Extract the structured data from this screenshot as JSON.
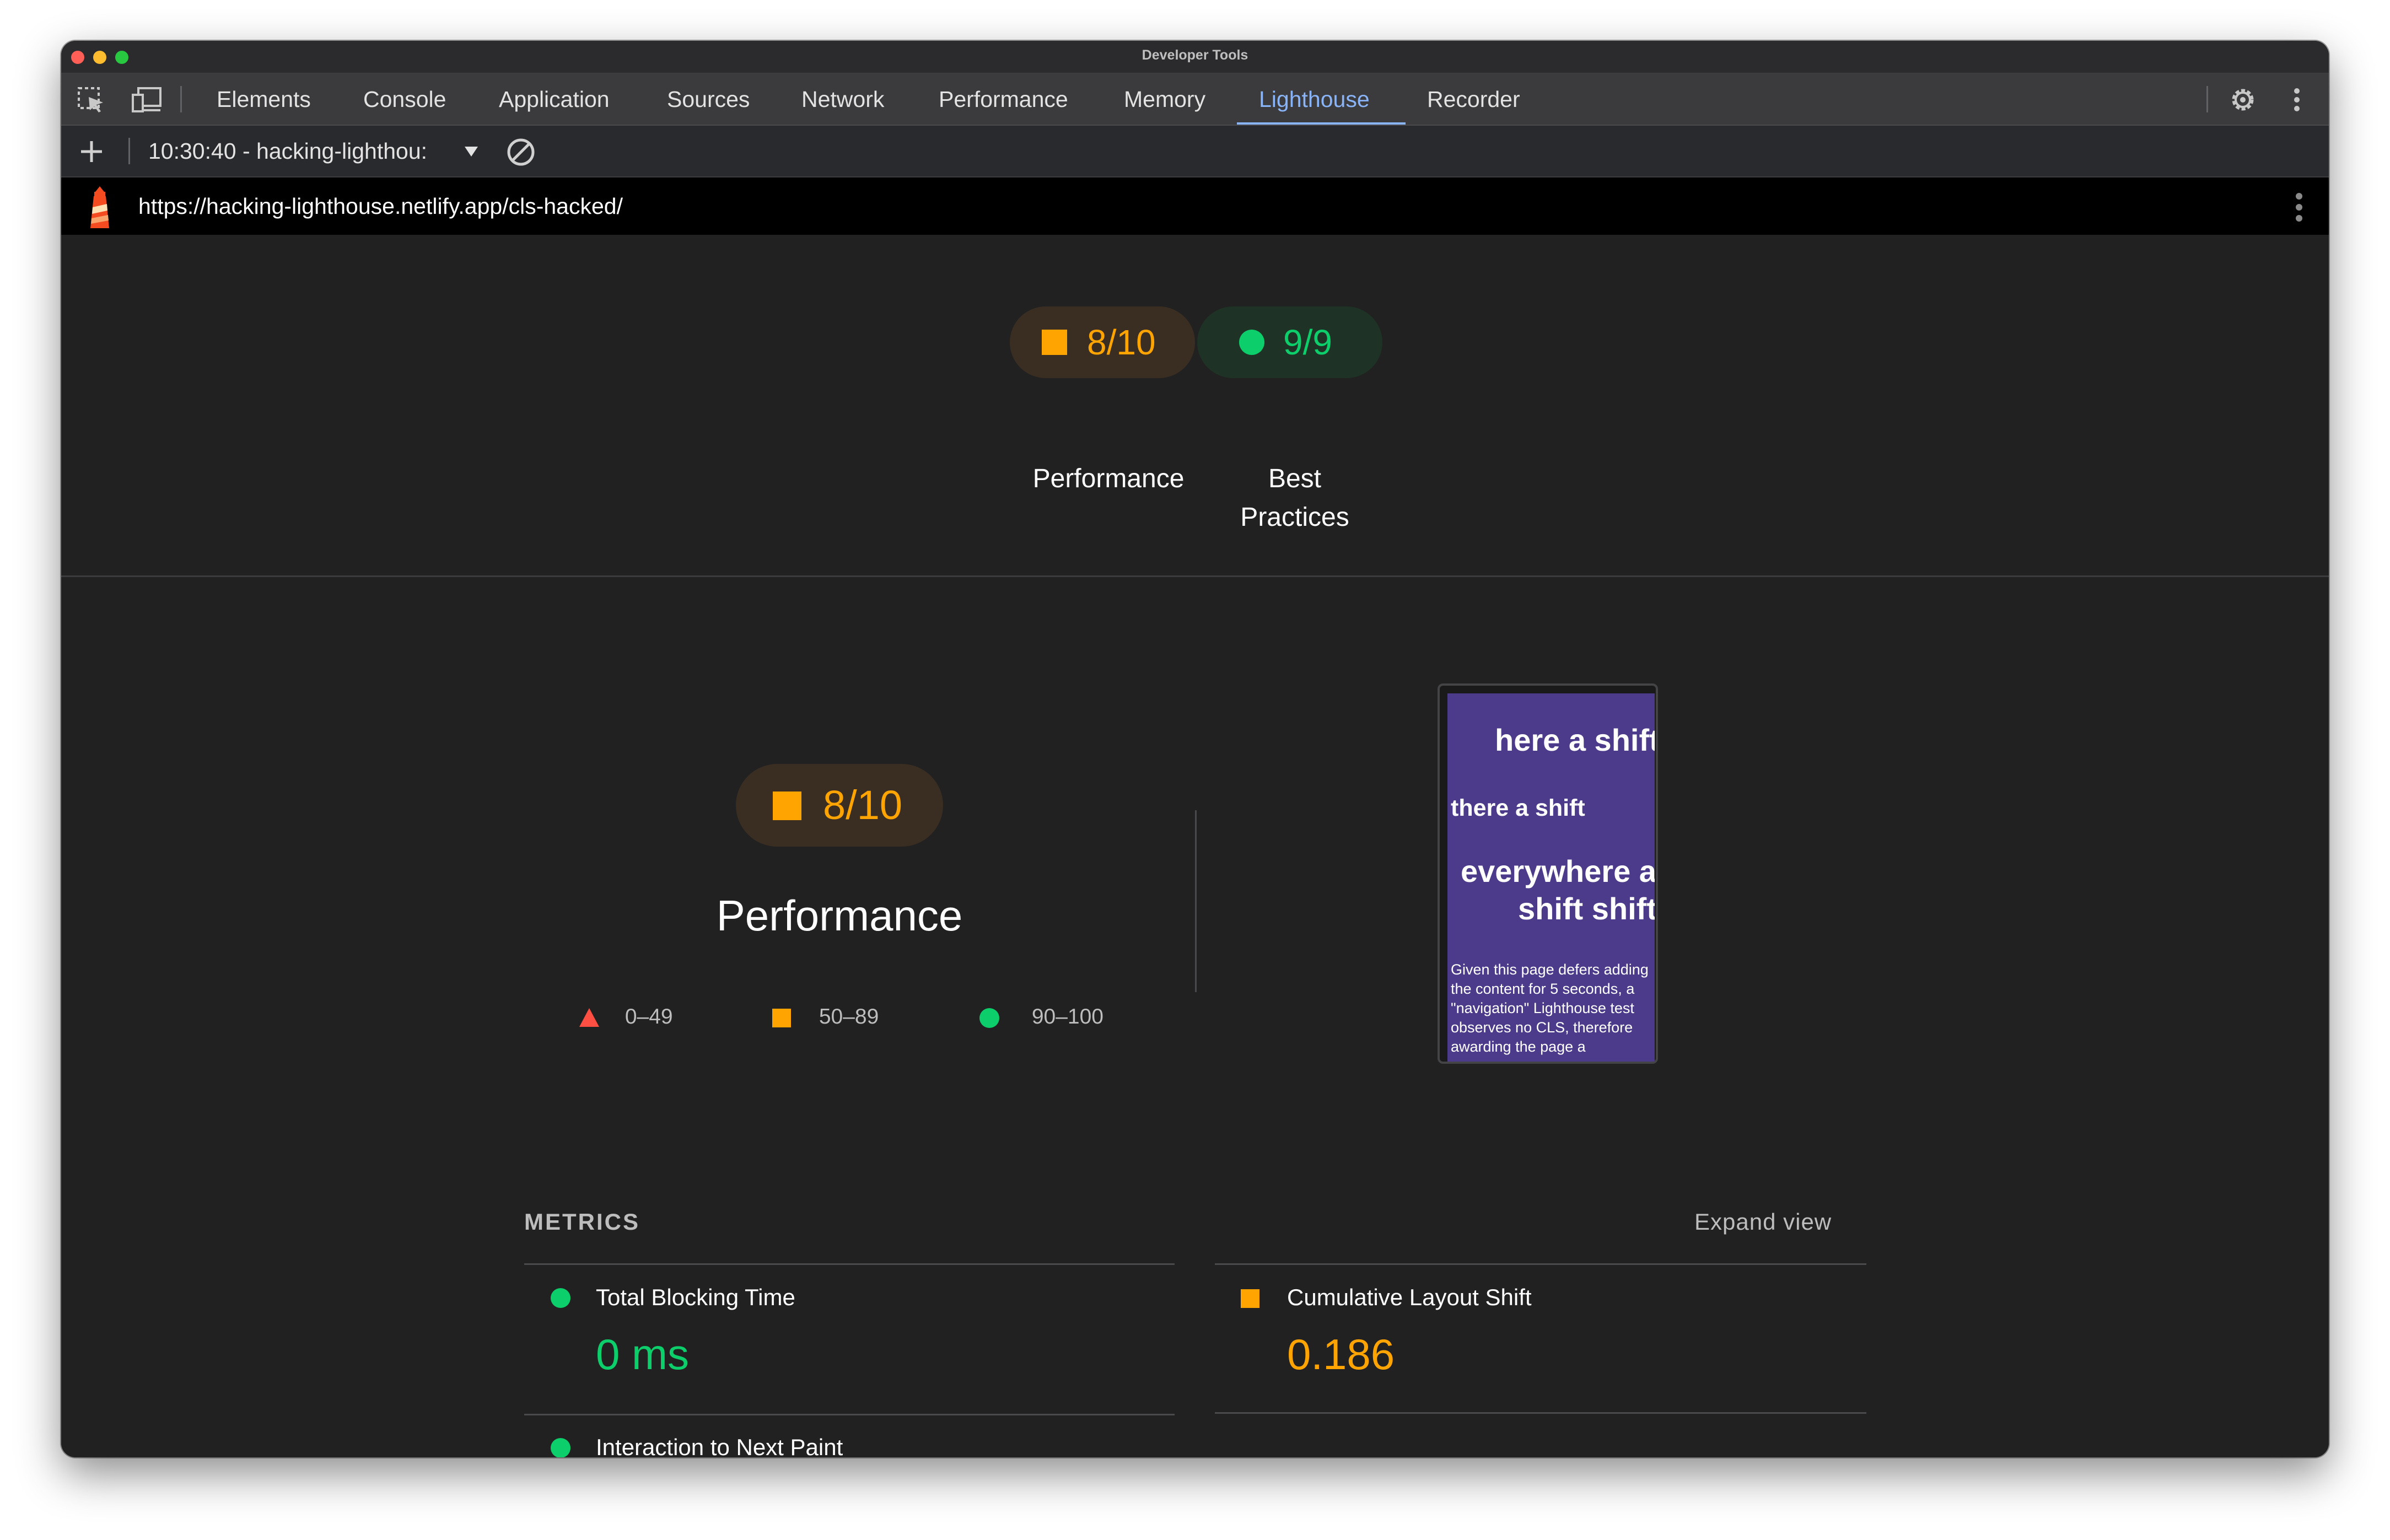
{
  "window": {
    "title": "Developer Tools"
  },
  "tabs": [
    {
      "label": "Elements"
    },
    {
      "label": "Console"
    },
    {
      "label": "Application"
    },
    {
      "label": "Sources"
    },
    {
      "label": "Network"
    },
    {
      "label": "Performance"
    },
    {
      "label": "Memory"
    },
    {
      "label": "Lighthouse",
      "active": true
    },
    {
      "label": "Recorder"
    }
  ],
  "toolbar": {
    "report_select": "10:30:40 - hacking-lighthou:"
  },
  "report": {
    "url": "https://hacking-lighthouse.netlify.app/cls-hacked/"
  },
  "summary": {
    "categories": [
      {
        "score": "8/10",
        "label_line1": "Performance",
        "label_line2": "",
        "status": "average"
      },
      {
        "score": "9/9",
        "label_line1": "Best",
        "label_line2": "Practices",
        "status": "pass"
      }
    ]
  },
  "performance": {
    "score": "8/10",
    "title": "Performance",
    "legend": [
      {
        "range": "0–49",
        "status": "fail"
      },
      {
        "range": "50–89",
        "status": "average"
      },
      {
        "range": "90–100",
        "status": "pass"
      }
    ]
  },
  "final_screenshot": {
    "line1": "here a shift",
    "line2": "there a shift",
    "line3": "everywhere a",
    "line4": "shift shift",
    "para1": "Given this page defers adding",
    "para2": "the content for 5 seconds, a",
    "para3": "\"navigation\" Lighthouse test",
    "para4": "observes no CLS, therefore",
    "para5": "awarding the page a"
  },
  "metrics": {
    "heading": "METRICS",
    "expand_label": "Expand view",
    "items": [
      {
        "name": "Total Blocking Time",
        "value": "0 ms",
        "status": "pass"
      },
      {
        "name": "Cumulative Layout Shift",
        "value": "0.186",
        "status": "average"
      },
      {
        "name": "Interaction to Next Paint",
        "value": "",
        "status": "pass"
      }
    ]
  },
  "colors": {
    "pass": "#0cce6b",
    "average": "#ffa400",
    "fail": "#ff4e42",
    "accent": "#8ab4f8"
  }
}
